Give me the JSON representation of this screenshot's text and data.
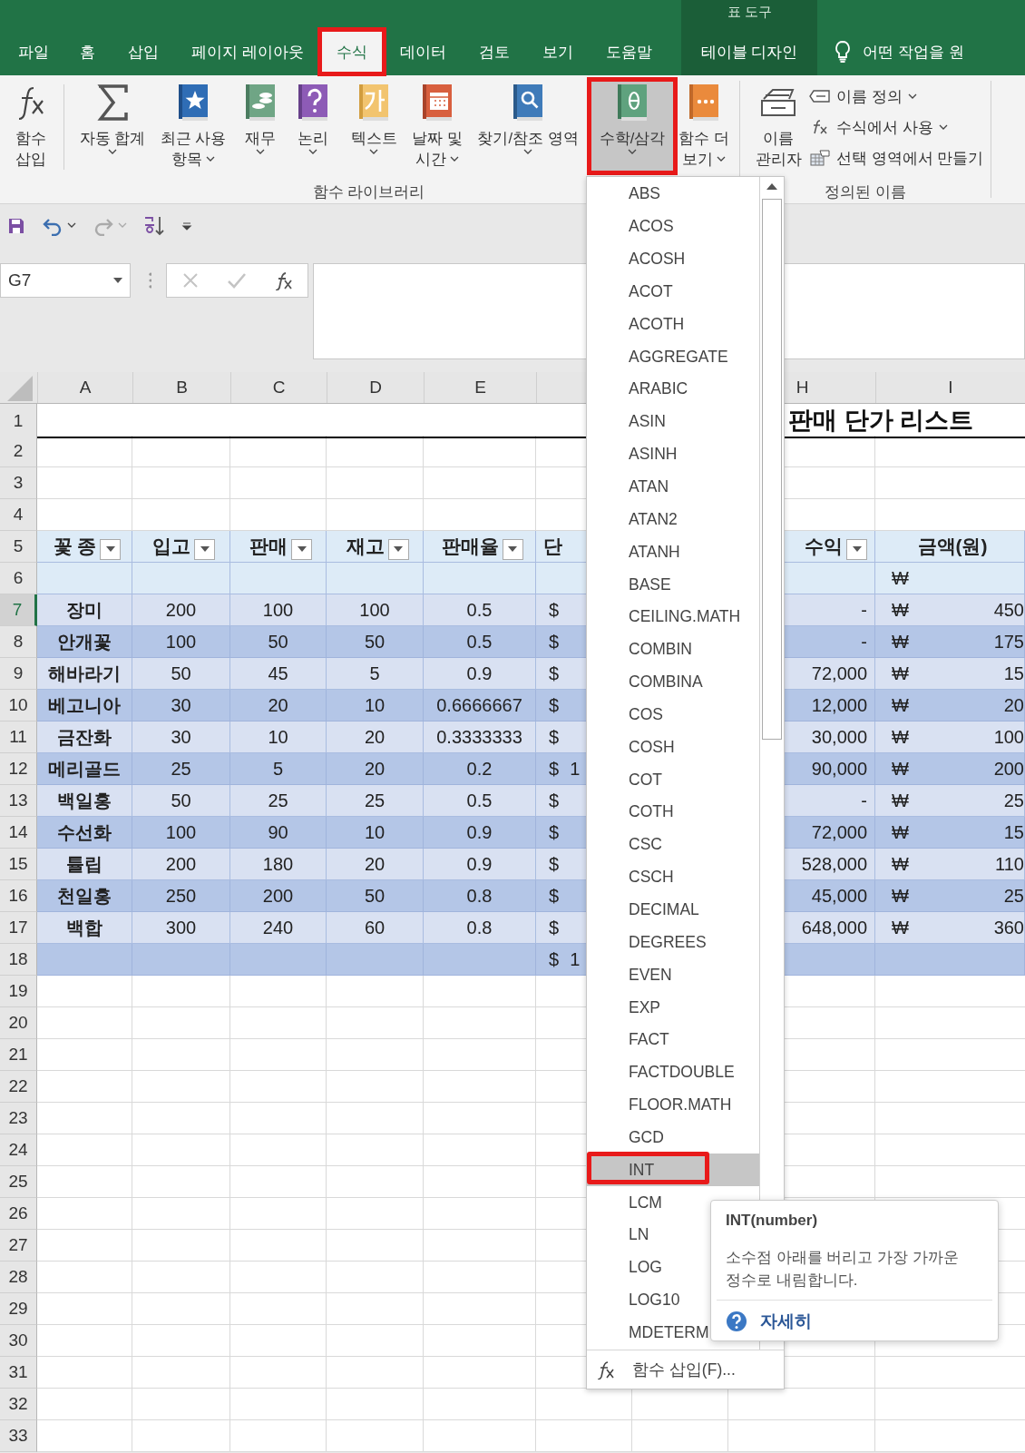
{
  "tabs": [
    {
      "label": "파일",
      "kind": "normal",
      "selected": false,
      "highlighted": false
    },
    {
      "label": "홈",
      "kind": "normal",
      "selected": false,
      "highlighted": false
    },
    {
      "label": "삽입",
      "kind": "normal",
      "selected": false,
      "highlighted": false
    },
    {
      "label": "페이지 레이아웃",
      "kind": "normal",
      "selected": false,
      "highlighted": false
    },
    {
      "label": "수식",
      "kind": "normal",
      "selected": true,
      "highlighted": true
    },
    {
      "label": "데이터",
      "kind": "normal",
      "selected": false,
      "highlighted": false
    },
    {
      "label": "검토",
      "kind": "normal",
      "selected": false,
      "highlighted": false
    },
    {
      "label": "보기",
      "kind": "normal",
      "selected": false,
      "highlighted": false
    },
    {
      "label": "도움말",
      "kind": "normal",
      "selected": false,
      "highlighted": false
    },
    {
      "label": "테이블 디자인",
      "kind": "contextual",
      "group": "표 도구",
      "selected": false,
      "highlighted": false
    }
  ],
  "tell_me": {
    "text": "어떤 작업을 원"
  },
  "ribbon": {
    "groups": [
      {
        "label": "함수 라이브러리",
        "buttons": [
          {
            "kind": "insert-function",
            "lines": [
              "함수",
              "삽입"
            ],
            "menu": false,
            "selected": false,
            "highlighted": false
          },
          {
            "kind": "autosum",
            "lines": [
              "자동 합계"
            ],
            "menu": true,
            "selected": false,
            "highlighted": false
          },
          {
            "kind": "recent",
            "lines": [
              "최근 사용",
              "항목"
            ],
            "menu": true,
            "selected": false,
            "highlighted": false
          },
          {
            "kind": "finance",
            "lines": [
              "재무"
            ],
            "menu": true,
            "selected": false,
            "highlighted": false
          },
          {
            "kind": "logic",
            "lines": [
              "논리"
            ],
            "menu": true,
            "selected": false,
            "highlighted": false
          },
          {
            "kind": "text",
            "lines": [
              "텍스트"
            ],
            "menu": true,
            "selected": false,
            "highlighted": false
          },
          {
            "kind": "datetime",
            "lines": [
              "날짜 및",
              "시간"
            ],
            "menu": true,
            "selected": false,
            "highlighted": false
          },
          {
            "kind": "lookup",
            "lines": [
              "찾기/참조 영역"
            ],
            "menu": true,
            "selected": false,
            "highlighted": false
          },
          {
            "kind": "math",
            "lines": [
              "수학/삼각"
            ],
            "menu": true,
            "selected": true,
            "highlighted": true
          },
          {
            "kind": "more",
            "lines": [
              "함수 더",
              "보기"
            ],
            "menu": true,
            "selected": false,
            "highlighted": false
          }
        ]
      },
      {
        "label": "정의된 이름",
        "buttons": [
          {
            "kind": "name-manager",
            "lines": [
              "이름",
              "관리자"
            ],
            "menu": false,
            "selected": false,
            "highlighted": false
          }
        ],
        "small_buttons": [
          {
            "kind": "define-name",
            "label": "이름 정의",
            "menu": true
          },
          {
            "kind": "use-in-formula",
            "label": "수식에서 사용",
            "menu": true
          },
          {
            "kind": "create-from-selection",
            "label": "선택 영역에서 만들기",
            "menu": false
          }
        ]
      }
    ]
  },
  "quick_access": [
    {
      "kind": "save",
      "menu": false,
      "disabled": false
    },
    {
      "kind": "undo",
      "menu": true,
      "disabled": false
    },
    {
      "kind": "redo",
      "menu": true,
      "disabled": true
    },
    {
      "kind": "sort",
      "menu": false,
      "disabled": false
    },
    {
      "kind": "customize",
      "menu": false,
      "disabled": false
    }
  ],
  "name_box": {
    "value": "G7"
  },
  "formula_buttons": [
    {
      "kind": "cancel",
      "disabled": true
    },
    {
      "kind": "enter",
      "disabled": true
    },
    {
      "kind": "insert-function",
      "disabled": false
    }
  ],
  "sheet": {
    "column_headers": [
      "A",
      "B",
      "C",
      "D",
      "E",
      "H",
      "I"
    ],
    "rows": [
      {
        "number": "1",
        "selected": false,
        "kind": "title",
        "title": "판매 단가 리스트"
      },
      {
        "number": "2",
        "selected": false,
        "kind": "blank"
      },
      {
        "number": "3",
        "selected": false,
        "kind": "blank"
      },
      {
        "number": "4",
        "selected": false,
        "kind": "blank"
      },
      {
        "number": "5",
        "selected": false,
        "kind": "header",
        "headers": [
          {
            "text": "꽃 종",
            "filter": true
          },
          {
            "text": "입고",
            "filter": true
          },
          {
            "text": "판매",
            "filter": true
          },
          {
            "text": "재고",
            "filter": true
          },
          {
            "text": "판매율",
            "filter": true
          },
          {
            "text": "단",
            "filter": false
          },
          {
            "text": "수익",
            "filter": true
          },
          {
            "text": "금액(원)",
            "filter": false
          }
        ]
      },
      {
        "number": "6",
        "selected": false,
        "kind": "subheader",
        "amount_currency": "₩"
      },
      {
        "number": "7",
        "selected": true,
        "kind": "data",
        "shaded": false,
        "flower": "장미",
        "stock_in": "200",
        "sold": "100",
        "stock": "100",
        "rate": "0.5",
        "price_currency": "$",
        "profit": "-",
        "amount_currency": "₩",
        "amount": "450"
      },
      {
        "number": "8",
        "selected": false,
        "kind": "data",
        "shaded": true,
        "flower": "안개꽃",
        "stock_in": "100",
        "sold": "50",
        "stock": "50",
        "rate": "0.5",
        "price_currency": "$",
        "profit": "-",
        "amount_currency": "₩",
        "amount": "175"
      },
      {
        "number": "9",
        "selected": false,
        "kind": "data",
        "shaded": false,
        "flower": "해바라기",
        "stock_in": "50",
        "sold": "45",
        "stock": "5",
        "rate": "0.9",
        "price_currency": "$",
        "profit": "72,000",
        "amount_currency": "₩",
        "amount": "15"
      },
      {
        "number": "10",
        "selected": false,
        "kind": "data",
        "shaded": true,
        "flower": "베고니아",
        "stock_in": "30",
        "sold": "20",
        "stock": "10",
        "rate": "0.6666667",
        "price_currency": "$",
        "profit": "12,000",
        "amount_currency": "₩",
        "amount": "20"
      },
      {
        "number": "11",
        "selected": false,
        "kind": "data",
        "shaded": false,
        "flower": "금잔화",
        "stock_in": "30",
        "sold": "10",
        "stock": "20",
        "rate": "0.3333333",
        "price_currency": "$",
        "profit": "30,000",
        "amount_currency": "₩",
        "amount": "100"
      },
      {
        "number": "12",
        "selected": false,
        "kind": "data",
        "shaded": true,
        "flower": "메리골드",
        "stock_in": "25",
        "sold": "5",
        "stock": "20",
        "rate": "0.2",
        "price_currency": "$",
        "price": "1",
        "profit": "90,000",
        "amount_currency": "₩",
        "amount": "200"
      },
      {
        "number": "13",
        "selected": false,
        "kind": "data",
        "shaded": false,
        "flower": "백일홍",
        "stock_in": "50",
        "sold": "25",
        "stock": "25",
        "rate": "0.5",
        "price_currency": "$",
        "profit": "-",
        "amount_currency": "₩",
        "amount": "25"
      },
      {
        "number": "14",
        "selected": false,
        "kind": "data",
        "shaded": true,
        "flower": "수선화",
        "stock_in": "100",
        "sold": "90",
        "stock": "10",
        "rate": "0.9",
        "price_currency": "$",
        "profit": "72,000",
        "amount_currency": "₩",
        "amount": "15"
      },
      {
        "number": "15",
        "selected": false,
        "kind": "data",
        "shaded": false,
        "flower": "튤립",
        "stock_in": "200",
        "sold": "180",
        "stock": "20",
        "rate": "0.9",
        "price_currency": "$",
        "profit": "528,000",
        "amount_currency": "₩",
        "amount": "110"
      },
      {
        "number": "16",
        "selected": false,
        "kind": "data",
        "shaded": true,
        "flower": "천일홍",
        "stock_in": "250",
        "sold": "200",
        "stock": "50",
        "rate": "0.8",
        "price_currency": "$",
        "profit": "45,000",
        "amount_currency": "₩",
        "amount": "25"
      },
      {
        "number": "17",
        "selected": false,
        "kind": "data",
        "shaded": false,
        "flower": "백합",
        "stock_in": "300",
        "sold": "240",
        "stock": "60",
        "rate": "0.8",
        "price_currency": "$",
        "profit": "648,000",
        "amount_currency": "₩",
        "amount": "360"
      },
      {
        "number": "18",
        "selected": false,
        "kind": "data",
        "shaded": true,
        "price_currency": "$",
        "price": "1"
      },
      {
        "number": "19",
        "selected": false,
        "kind": "blank"
      },
      {
        "number": "20",
        "selected": false,
        "kind": "blank"
      },
      {
        "number": "21",
        "selected": false,
        "kind": "blank"
      },
      {
        "number": "22",
        "selected": false,
        "kind": "blank"
      },
      {
        "number": "23",
        "selected": false,
        "kind": "blank"
      },
      {
        "number": "24",
        "selected": false,
        "kind": "blank"
      },
      {
        "number": "25",
        "selected": false,
        "kind": "blank"
      },
      {
        "number": "26",
        "selected": false,
        "kind": "blank"
      },
      {
        "number": "27",
        "selected": false,
        "kind": "blank"
      },
      {
        "number": "28",
        "selected": false,
        "kind": "blank"
      },
      {
        "number": "29",
        "selected": false,
        "kind": "blank"
      },
      {
        "number": "30",
        "selected": false,
        "kind": "blank"
      },
      {
        "number": "31",
        "selected": false,
        "kind": "blank"
      },
      {
        "number": "32",
        "selected": false,
        "kind": "blank"
      },
      {
        "number": "33",
        "selected": false,
        "kind": "blank"
      }
    ]
  },
  "function_menu": {
    "items": [
      {
        "label": "ABS",
        "selected": false,
        "highlighted": false
      },
      {
        "label": "ACOS",
        "selected": false,
        "highlighted": false
      },
      {
        "label": "ACOSH",
        "selected": false,
        "highlighted": false
      },
      {
        "label": "ACOT",
        "selected": false,
        "highlighted": false
      },
      {
        "label": "ACOTH",
        "selected": false,
        "highlighted": false
      },
      {
        "label": "AGGREGATE",
        "selected": false,
        "highlighted": false
      },
      {
        "label": "ARABIC",
        "selected": false,
        "highlighted": false
      },
      {
        "label": "ASIN",
        "selected": false,
        "highlighted": false
      },
      {
        "label": "ASINH",
        "selected": false,
        "highlighted": false
      },
      {
        "label": "ATAN",
        "selected": false,
        "highlighted": false
      },
      {
        "label": "ATAN2",
        "selected": false,
        "highlighted": false
      },
      {
        "label": "ATANH",
        "selected": false,
        "highlighted": false
      },
      {
        "label": "BASE",
        "selected": false,
        "highlighted": false
      },
      {
        "label": "CEILING.MATH",
        "selected": false,
        "highlighted": false
      },
      {
        "label": "COMBIN",
        "selected": false,
        "highlighted": false
      },
      {
        "label": "COMBINA",
        "selected": false,
        "highlighted": false
      },
      {
        "label": "COS",
        "selected": false,
        "highlighted": false
      },
      {
        "label": "COSH",
        "selected": false,
        "highlighted": false
      },
      {
        "label": "COT",
        "selected": false,
        "highlighted": false
      },
      {
        "label": "COTH",
        "selected": false,
        "highlighted": false
      },
      {
        "label": "CSC",
        "selected": false,
        "highlighted": false
      },
      {
        "label": "CSCH",
        "selected": false,
        "highlighted": false
      },
      {
        "label": "DECIMAL",
        "selected": false,
        "highlighted": false
      },
      {
        "label": "DEGREES",
        "selected": false,
        "highlighted": false
      },
      {
        "label": "EVEN",
        "selected": false,
        "highlighted": false
      },
      {
        "label": "EXP",
        "selected": false,
        "highlighted": false
      },
      {
        "label": "FACT",
        "selected": false,
        "highlighted": false
      },
      {
        "label": "FACTDOUBLE",
        "selected": false,
        "highlighted": false
      },
      {
        "label": "FLOOR.MATH",
        "selected": false,
        "highlighted": false
      },
      {
        "label": "GCD",
        "selected": false,
        "highlighted": false
      },
      {
        "label": "INT",
        "selected": true,
        "highlighted": true
      },
      {
        "label": "LCM",
        "selected": false,
        "highlighted": false
      },
      {
        "label": "LN",
        "selected": false,
        "highlighted": false
      },
      {
        "label": "LOG",
        "selected": false,
        "highlighted": false
      },
      {
        "label": "LOG10",
        "selected": false,
        "highlighted": false
      },
      {
        "label": "MDETERM",
        "selected": false,
        "highlighted": false
      }
    ],
    "footer": "함수 삽입(F)..."
  },
  "tooltip": {
    "title": "INT(number)",
    "description": "소수점 아래를 버리고 가장 가까운 정수로 내림합니다.",
    "link": "자세히"
  }
}
